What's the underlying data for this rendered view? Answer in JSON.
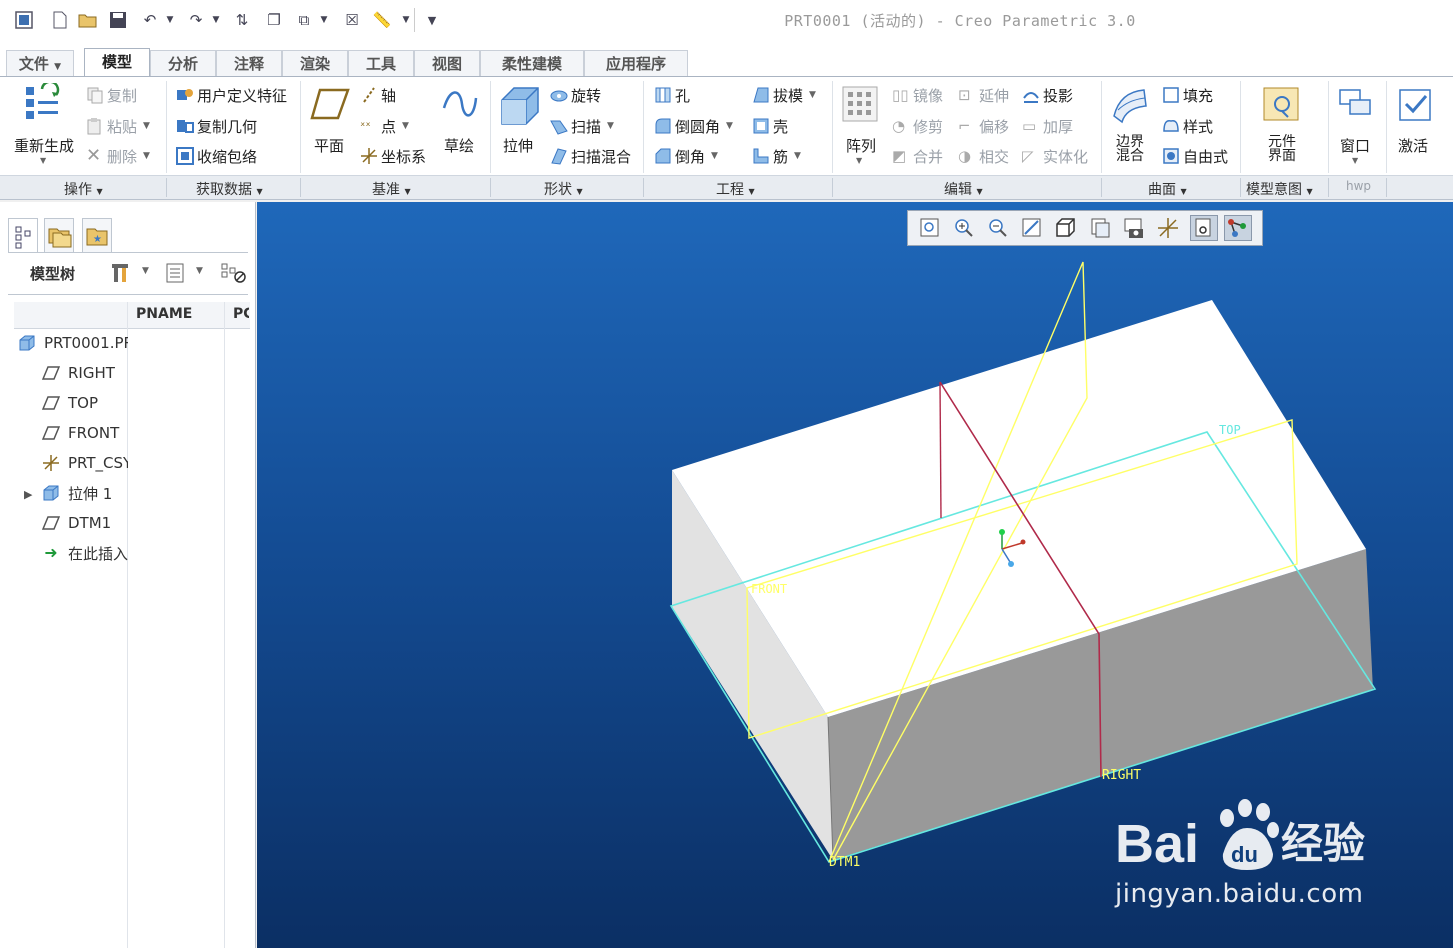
{
  "title": "PRT0001 (活动的) - Creo Parametric 3.0",
  "tabs": [
    "文件",
    "模型",
    "分析",
    "注释",
    "渲染",
    "工具",
    "视图",
    "柔性建模",
    "应用程序"
  ],
  "ribbon": {
    "regenerate": "重新生成",
    "copy": "复制",
    "paste": "粘贴",
    "delete": "删除",
    "udf": "用户定义特征",
    "copy_geom": "复制几何",
    "shrinkwrap": "收缩包络",
    "plane": "平面",
    "axis": "轴",
    "point": "点",
    "csys": "坐标系",
    "sketch": "草绘",
    "extrude": "拉伸",
    "revolve": "旋转",
    "sweep": "扫描",
    "swept_blend": "扫描混合",
    "hole": "孔",
    "round": "倒圆角",
    "chamfer": "倒角",
    "draft": "拔模",
    "shell": "壳",
    "rib": "筋",
    "pattern": "阵列",
    "mirror": "镜像",
    "extend": "延伸",
    "project": "投影",
    "trim": "修剪",
    "offset": "偏移",
    "thicken": "加厚",
    "merge": "合并",
    "intersect": "相交",
    "solidify": "实体化",
    "boundary_blend": "边界混合",
    "fill": "填充",
    "style": "样式",
    "freestyle": "自由式",
    "component_interface": "元件界面",
    "window": "窗口",
    "activate": "激活"
  },
  "groups": {
    "operations": "操作",
    "get_data": "获取数据",
    "datum": "基准",
    "shapes": "形状",
    "engineering": "工程",
    "editing": "编辑",
    "surfaces": "曲面",
    "model_intent": "模型意图",
    "hwp": "hwp"
  },
  "model_tree": {
    "label": "模型树",
    "col_pname": "PNAME",
    "col_po": "PC",
    "items": [
      "PRT0001.PR",
      "RIGHT",
      "TOP",
      "FRONT",
      "PRT_CSY",
      "拉伸 1",
      "DTM1",
      "在此插入"
    ]
  },
  "datum_labels": {
    "top": "TOP",
    "front": "FRONT",
    "right": "RIGHT",
    "dtm1": "DTM1"
  },
  "watermark": {
    "brand": "Bai",
    "brand2": "经验",
    "url": "jingyan.baidu.com"
  },
  "colors": {
    "viewport_top": "#1f68ba",
    "viewport_bottom": "#0b2f64",
    "datum_yellow": "#ffff66",
    "datum_cyan": "#66e8e0",
    "section_red": "#b02a4a"
  }
}
